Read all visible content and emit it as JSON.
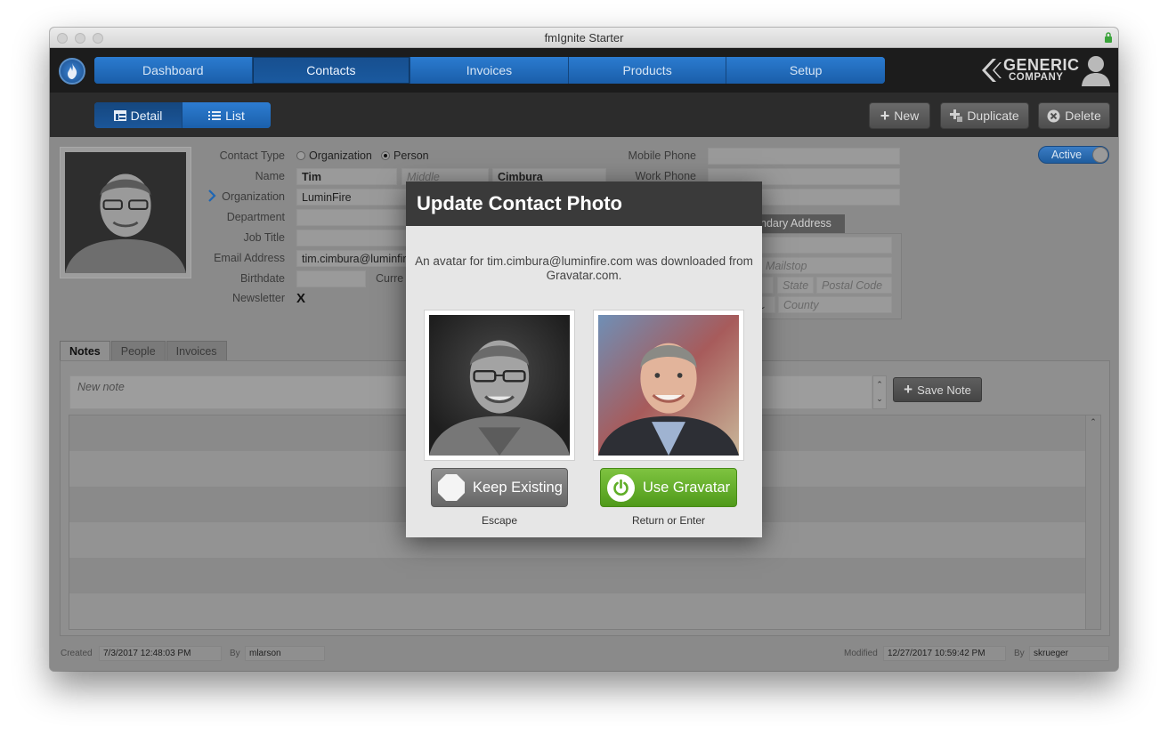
{
  "window": {
    "title": "fmIgnite Starter"
  },
  "nav": {
    "tabs": [
      "Dashboard",
      "Contacts",
      "Invoices",
      "Products",
      "Setup"
    ],
    "active": "Contacts",
    "brand": {
      "line1": "GENERIC",
      "line2": "COMPANY"
    }
  },
  "toolbar": {
    "view_detail": "Detail",
    "view_list": "List",
    "new_label": "New",
    "duplicate_label": "Duplicate",
    "delete_label": "Delete"
  },
  "contact": {
    "labels": {
      "contact_type": "Contact Type",
      "name": "Name",
      "organization": "Organization",
      "department": "Department",
      "job_title": "Job Title",
      "email": "Email Address",
      "birthdate": "Birthdate",
      "newsletter": "Newsletter",
      "current_partial": "Curre",
      "mobile_phone": "Mobile Phone",
      "work_phone": "Work Phone"
    },
    "type_options": [
      "Organization",
      "Person"
    ],
    "type_selected": "Person",
    "first_name": "Tim",
    "middle_placeholder": "Middle",
    "last_name": "Cimbura",
    "organization": "LuminFire",
    "email": "tim.cimbura@luminfire",
    "newsletter_mark": "X",
    "status_toggle": "Active",
    "address_tab_partial": "ndary Address",
    "address_placeholder_partial": ", Mailstop",
    "state_label": "State",
    "postal_code_label": "Postal Code",
    "county_placeholder": "County"
  },
  "tabs": {
    "items": [
      "Notes",
      "People",
      "Invoices"
    ],
    "active": "Notes"
  },
  "notes": {
    "placeholder": "New note",
    "save_label": "Save Note"
  },
  "footer": {
    "created_label": "Created",
    "created_value": "7/3/2017 12:48:03 PM",
    "by_label": "By",
    "created_by": "mlarson",
    "modified_label": "Modified",
    "modified_value": "12/27/2017 10:59:42 PM",
    "modified_by": "skrueger"
  },
  "modal": {
    "title": "Update Contact Photo",
    "message": "An avatar for tim.cimbura@luminfire.com was downloaded from Gravatar.com.",
    "keep_label": "Keep Existing",
    "keep_hint": "Escape",
    "use_label": "Use Gravatar",
    "use_hint": "Return or Enter"
  },
  "colors": {
    "nav_blue": "#1f66b3",
    "use_green": "#5fae27",
    "keep_gray": "#7a7a7a",
    "modal_header": "#3a3a3a"
  },
  "icons": [
    "app-flame-icon",
    "detail-icon",
    "list-icon",
    "plus-icon",
    "duplicate-icon",
    "delete-icon",
    "chevron-right-icon",
    "user-icon",
    "stop-icon",
    "power-icon",
    "lock-icon"
  ]
}
